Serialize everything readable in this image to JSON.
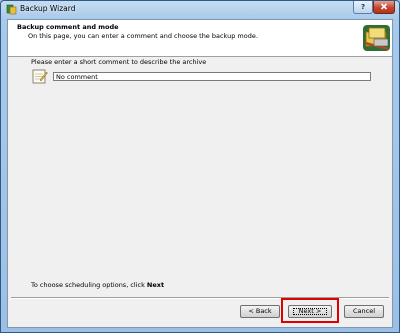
{
  "window": {
    "title": "Backup Wizard",
    "help_label": "?"
  },
  "header": {
    "title": "Backup comment and mode",
    "subtitle": "On this page, you can enter a comment and choose the backup mode."
  },
  "comment": {
    "prompt": "Please enter a short comment to describe the archive",
    "value": "No comment"
  },
  "footer": {
    "hint_prefix": "To choose scheduling options, click ",
    "hint_bold": "Next"
  },
  "buttons": {
    "back": "< Back",
    "next": "Next >",
    "cancel": "Cancel"
  },
  "colors": {
    "highlight": "#e00000",
    "titlebar": "#a9c9ea"
  },
  "icons": {
    "app": "backup-app-icon",
    "header": "backup-drive-icon",
    "note": "notepad-pencil-icon",
    "close": "close-icon"
  }
}
